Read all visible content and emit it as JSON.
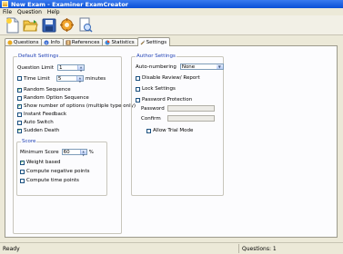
{
  "window": {
    "title": "New Exam - Examiner ExamCreator"
  },
  "menu": [
    "File",
    "Question",
    "Help"
  ],
  "toolbar": {
    "icons": [
      "new-document-icon",
      "open-folder-icon",
      "save-disk-icon",
      "settings-gear-icon",
      "preview-icon"
    ]
  },
  "tabs": [
    {
      "label": "Questions",
      "icon": "questions-icon"
    },
    {
      "label": "Info",
      "icon": "info-icon"
    },
    {
      "label": "References",
      "icon": "references-icon"
    },
    {
      "label": "Statistics",
      "icon": "statistics-icon"
    },
    {
      "label": "Settings",
      "icon": "settings-icon",
      "active": true
    }
  ],
  "default_settings": {
    "title": "Default Settings",
    "question_limit": {
      "label": "Question Limit",
      "value": "1",
      "checked": false
    },
    "time_limit": {
      "label": "Time Limit",
      "value": "5",
      "unit": "minutes",
      "checked": false
    },
    "options": [
      {
        "label": "Random Sequence",
        "checked": true
      },
      {
        "label": "Random Option Sequence",
        "checked": false
      },
      {
        "label": "Show number of options (multiple type only)",
        "checked": true
      },
      {
        "label": "Instant Feedback",
        "checked": false
      },
      {
        "label": "Auto Switch",
        "checked": false
      },
      {
        "label": "Sudden Death",
        "checked": true
      }
    ],
    "score": {
      "title": "Score",
      "minimum_label": "Minimum Score",
      "minimum_value": "60",
      "minimum_unit": "%",
      "options": [
        {
          "label": "Weight based",
          "checked": true
        },
        {
          "label": "Compute negative points",
          "checked": false
        },
        {
          "label": "Compute time points",
          "checked": false
        }
      ]
    }
  },
  "author_settings": {
    "title": "Author Settings",
    "auto_numbering_label": "Auto-numbering",
    "auto_numbering_value": "None",
    "options": [
      {
        "label": "Disable Review/ Report",
        "checked": false
      },
      {
        "label": "Lock Settings",
        "checked": false
      },
      {
        "label": "Password Protection",
        "checked": false
      }
    ],
    "password_label": "Password",
    "confirm_label": "Confirm",
    "allow_trial": {
      "label": "Allow Trial Mode",
      "checked": false
    }
  },
  "status": {
    "left": "Ready",
    "right": "Questions: 1"
  }
}
